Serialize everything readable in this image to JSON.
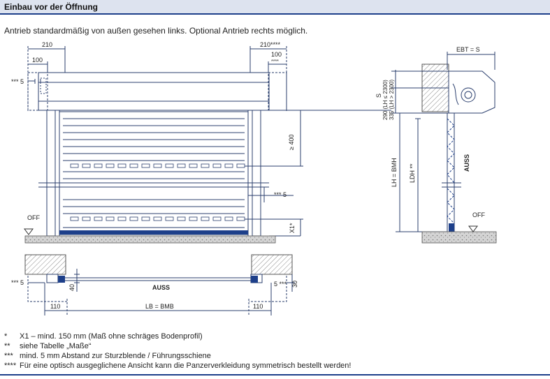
{
  "header": {
    "title": "Einbau vor der Öffnung"
  },
  "intro": "Antrieb standardmäßig von außen gesehen links. Optional Antrieb rechts möglich.",
  "front_view": {
    "dim_210_left": "210",
    "dim_100_left": "100",
    "dim_210_right": "210****",
    "dim_100_right": "100",
    "dim_100_right_note": "****",
    "mark_5_top_left": "*** 5",
    "dim_400": "≥ 400",
    "mark_5_right": "*** 5",
    "dim_x1": "X1*",
    "off_label": "OFF"
  },
  "side_view": {
    "ebt": "EBT = S",
    "s": "S",
    "h290": "290 (LH ≤ 2300)",
    "h335": "335 (LH > 2300)",
    "lh": "LH = BMH",
    "ldh": "LDH **",
    "auss": "AUSS",
    "off_label": "OFF"
  },
  "plan_view": {
    "mark_5_left": "*** 5",
    "auss": "AUSS",
    "dim_40": "40",
    "mark_5_right": "5 ***",
    "dim_30": "30",
    "dim_110_left": "110",
    "lb": "LB = BMB",
    "dim_110_right": "110"
  },
  "footnotes": [
    {
      "key": "*",
      "text": "X1 – mind. 150 mm (Maß ohne schräges Bodenprofil)"
    },
    {
      "key": "**",
      "text": "siehe Tabelle „Maße“"
    },
    {
      "key": "***",
      "text": "mind. 5 mm Abstand zur Sturzblende / Führungsschiene"
    },
    {
      "key": "****",
      "text": "Für eine optisch ausgeglichene Ansicht kann die Panzerverkleidung symmetrisch bestellt werden!"
    }
  ],
  "colors": {
    "accent": "#1d3f8a",
    "line": "#2b3f6e",
    "hatch": "#8a8a8a",
    "header_bg": "#dde3ef"
  }
}
